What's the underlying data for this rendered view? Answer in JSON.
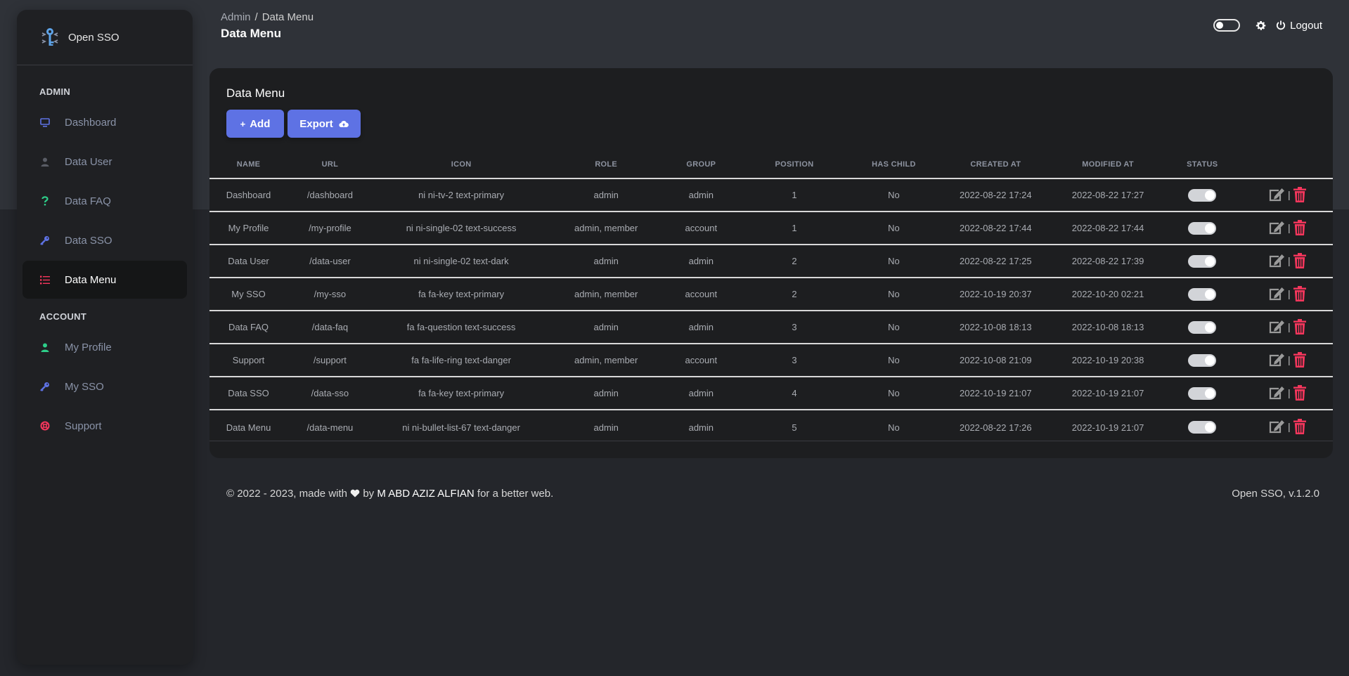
{
  "brand": {
    "name": "Open SSO"
  },
  "sidebar": {
    "admin_title": "ADMIN",
    "account_title": "ACCOUNT",
    "admin_items": [
      {
        "label": "Dashboard",
        "icon": "monitor-icon",
        "color": "#5e72e4"
      },
      {
        "label": "Data User",
        "icon": "user-icon",
        "color": "#5a5d66"
      },
      {
        "label": "Data FAQ",
        "icon": "question-icon",
        "color": "#2dce89"
      },
      {
        "label": "Data SSO",
        "icon": "key-icon",
        "color": "#5e72e4"
      },
      {
        "label": "Data Menu",
        "icon": "bullet-list-icon",
        "color": "#f5365c",
        "active": true
      }
    ],
    "account_items": [
      {
        "label": "My Profile",
        "icon": "user-icon",
        "color": "#2dce89"
      },
      {
        "label": "My SSO",
        "icon": "key-icon",
        "color": "#5e72e4"
      },
      {
        "label": "Support",
        "icon": "life-ring-icon",
        "color": "#f5365c"
      }
    ]
  },
  "header": {
    "breadcrumb_root": "Admin",
    "breadcrumb_sep": "/",
    "breadcrumb_current": "Data Menu",
    "page_title": "Data Menu",
    "logout_label": "Logout"
  },
  "card": {
    "title": "Data Menu",
    "add_label": "Add",
    "export_label": "Export"
  },
  "table": {
    "headers": [
      "NAME",
      "URL",
      "ICON",
      "ROLE",
      "GROUP",
      "POSITION",
      "HAS CHILD",
      "CREATED AT",
      "MODIFIED AT",
      "STATUS",
      ""
    ],
    "rows": [
      [
        "Dashboard",
        "/dashboard",
        "ni ni-tv-2 text-primary",
        "admin",
        "admin",
        "1",
        "No",
        "2022-08-22 17:24",
        "2022-08-22 17:27"
      ],
      [
        "My Profile",
        "/my-profile",
        "ni ni-single-02 text-success",
        "admin, member",
        "account",
        "1",
        "No",
        "2022-08-22 17:44",
        "2022-08-22 17:44"
      ],
      [
        "Data User",
        "/data-user",
        "ni ni-single-02 text-dark",
        "admin",
        "admin",
        "2",
        "No",
        "2022-08-22 17:25",
        "2022-08-22 17:39"
      ],
      [
        "My SSO",
        "/my-sso",
        "fa fa-key text-primary",
        "admin, member",
        "account",
        "2",
        "No",
        "2022-10-19 20:37",
        "2022-10-20 02:21"
      ],
      [
        "Data FAQ",
        "/data-faq",
        "fa fa-question text-success",
        "admin",
        "admin",
        "3",
        "No",
        "2022-10-08 18:13",
        "2022-10-08 18:13"
      ],
      [
        "Support",
        "/support",
        "fa fa-life-ring text-danger",
        "admin, member",
        "account",
        "3",
        "No",
        "2022-10-08 21:09",
        "2022-10-19 20:38"
      ],
      [
        "Data SSO",
        "/data-sso",
        "fa fa-key text-primary",
        "admin",
        "admin",
        "4",
        "No",
        "2022-10-19 21:07",
        "2022-10-19 21:07"
      ],
      [
        "Data Menu",
        "/data-menu",
        "ni ni-bullet-list-67 text-danger",
        "admin",
        "admin",
        "5",
        "No",
        "2022-08-22 17:26",
        "2022-10-19 21:07"
      ]
    ],
    "action_separator": "|"
  },
  "footer": {
    "prefix": "© 2022 - 2023, made with",
    "by": "by",
    "author": "M ABD AZIZ ALFIAN",
    "suffix": "for a better web.",
    "version": "Open SSO, v.1.2.0"
  },
  "colors": {
    "accent": "#5e72e4",
    "danger": "#f5365c",
    "success": "#2dce89"
  }
}
